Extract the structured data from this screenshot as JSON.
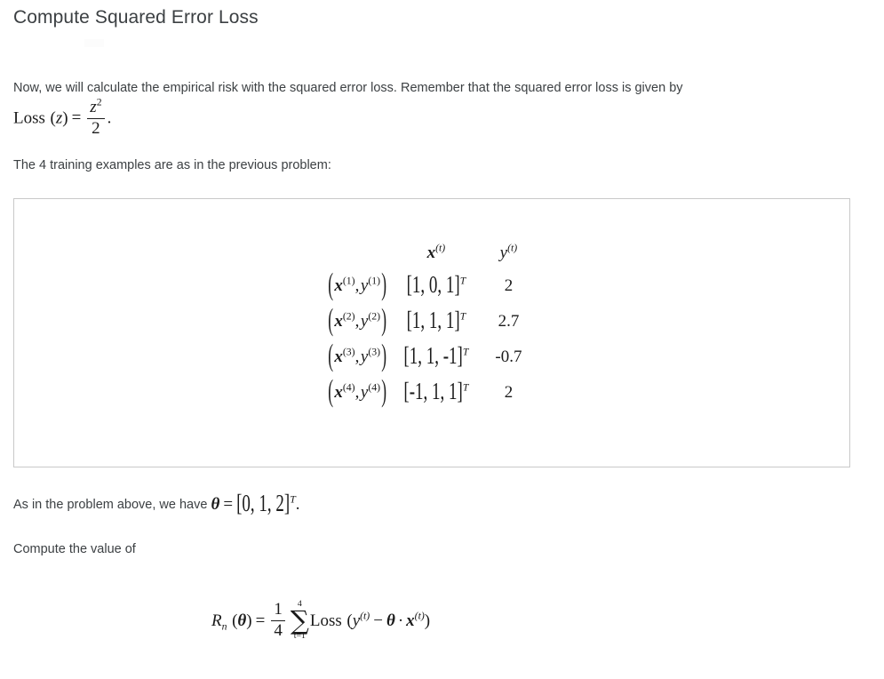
{
  "page": {
    "title": "Compute Squared Error Loss",
    "background_color": "#ffffff",
    "text_color": "#3c4043",
    "math_color": "#1a1a1a",
    "box_border_color": "#c9c9c9"
  },
  "intro": {
    "paragraph": "Now, we will calculate the empirical risk with the squared error loss. Remember that the squared error loss is given by",
    "examples_intro": "The 4 training examples are as in the previous problem:"
  },
  "loss_definition": {
    "lhs_name": "Loss",
    "argument": "z",
    "numerator": "z",
    "numerator_exponent": "2",
    "denominator": "2",
    "trailing_punctuation": ".",
    "equals": "=",
    "latex": "\\mathrm{Loss}(z) = \\frac{z^2}{2}."
  },
  "examples_table": {
    "headers": {
      "label_col": "",
      "x_col": "x",
      "x_col_sup": "(t)",
      "y_col": "y",
      "y_col_sup": "(t)"
    },
    "rows": [
      {
        "index": "1",
        "pair_x": "x",
        "pair_y": "y",
        "x_vector": "[1, 0, 1]",
        "x_components": [
          1,
          0,
          1
        ],
        "transpose": "T",
        "y_value": "2"
      },
      {
        "index": "2",
        "pair_x": "x",
        "pair_y": "y",
        "x_vector": "[1, 1, 1]",
        "x_components": [
          1,
          1,
          1
        ],
        "transpose": "T",
        "y_value": "2.7"
      },
      {
        "index": "3",
        "pair_x": "x",
        "pair_y": "y",
        "x_vector": "[1, 1, -1]",
        "x_components": [
          1,
          1,
          -1
        ],
        "transpose": "T",
        "y_value": "-0.7"
      },
      {
        "index": "4",
        "pair_x": "x",
        "pair_y": "y",
        "x_vector": "[-1, 1, 1]",
        "x_components": [
          -1,
          1,
          1
        ],
        "transpose": "T",
        "y_value": "2"
      }
    ]
  },
  "theta_statement": {
    "lead_text": "As in the problem above, we have ",
    "symbol": "θ",
    "equals": "=",
    "value": "[0, 1, 2]",
    "components": [
      0,
      1,
      2
    ],
    "transpose": "T",
    "trailing_punctuation": "."
  },
  "compute_prompt": {
    "text": "Compute the value of"
  },
  "risk_formula": {
    "lhs_symbol": "R",
    "lhs_subscript": "n",
    "lhs_argument": "θ",
    "equals": "=",
    "fraction_numerator": "1",
    "fraction_denominator": "4",
    "sum_upper_limit": "4",
    "sum_lower_limit": "t=1",
    "sum_symbol": "∑",
    "loss_name": "Loss",
    "loss_arg_y": "y",
    "loss_arg_y_sup": "(t)",
    "minus": "−",
    "theta_symbol": "θ",
    "dot": "·",
    "loss_arg_x": "x",
    "loss_arg_x_sup": "(t)",
    "latex": "R_n(\\theta) = \\frac{1}{4}\\sum_{t=1}^{4}\\mathrm{Loss}(y^{(t)} - \\theta \\cdot x^{(t)})"
  }
}
